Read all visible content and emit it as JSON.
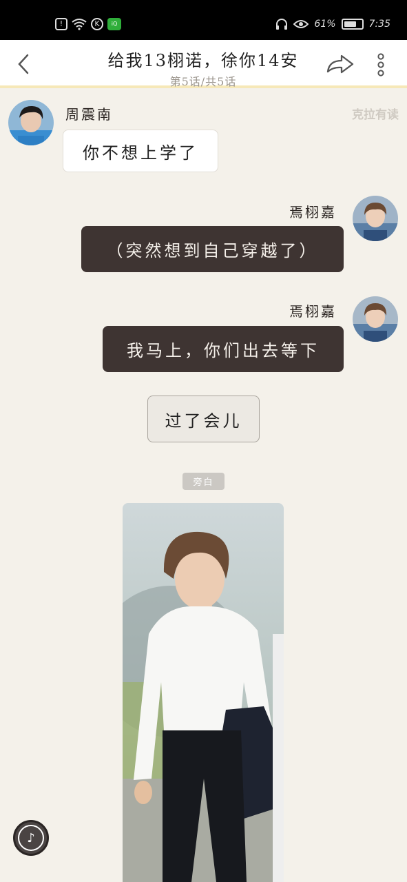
{
  "status_bar": {
    "battery": "61%",
    "time": "7:35",
    "icons": [
      "alert-icon",
      "wifi-icon",
      "k-icon",
      "iqiyi-icon",
      "headset-icon",
      "eye-icon",
      "battery-icon"
    ]
  },
  "header": {
    "title": "给我13栩诺，徐你14安",
    "subtitle": "第5话/共5话",
    "back_icon": "chevron-left-icon",
    "share_icon": "share-arrow-icon",
    "more_icon": "more-vertical-icon"
  },
  "watermark": "克拉有读",
  "messages": [
    {
      "side": "left",
      "speaker": "周震南",
      "text": "你不想上学了"
    },
    {
      "side": "right",
      "speaker": "焉栩嘉",
      "text": "（突然想到自己穿越了）"
    },
    {
      "side": "right",
      "speaker": "焉栩嘉",
      "text": "我马上，你们出去等下"
    }
  ],
  "narration": "过了会儿",
  "aside_label": "旁白",
  "colors": {
    "background": "#f4f1ea",
    "dark_bubble": "#3e3432",
    "header_underline": "#f6e8b8"
  }
}
